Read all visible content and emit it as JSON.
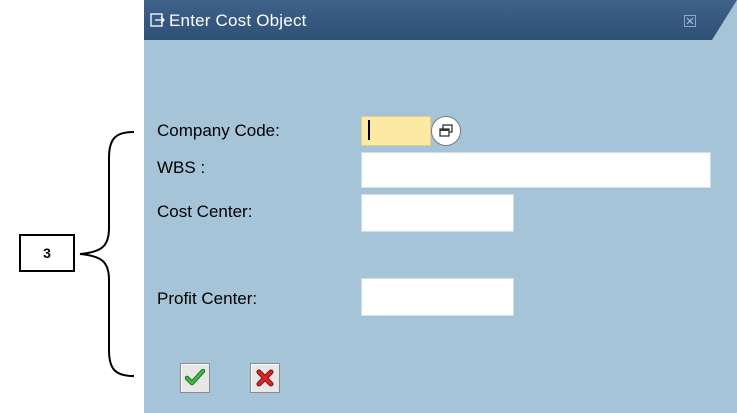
{
  "annotation": {
    "callout_number": "3"
  },
  "dialog": {
    "title": "Enter Cost Object",
    "title_icon": "dialog-icon",
    "close_icon": "close-icon",
    "fields": {
      "company_code_label": "Company Code:",
      "company_code_value": "",
      "wbs_label": "WBS :",
      "wbs_value": "",
      "cost_center_label": "Cost Center:",
      "cost_center_value": "",
      "profit_center_label": "Profit Center:",
      "profit_center_value": ""
    },
    "buttons": {
      "confirm_icon": "checkmark-icon",
      "cancel_icon": "cross-icon"
    },
    "colors": {
      "background": "#a6c4d8",
      "titlebar": "#2f5077",
      "required_field": "#fbe9a4",
      "confirm": "#2c9a2c",
      "cancel": "#cc1d1d"
    }
  }
}
